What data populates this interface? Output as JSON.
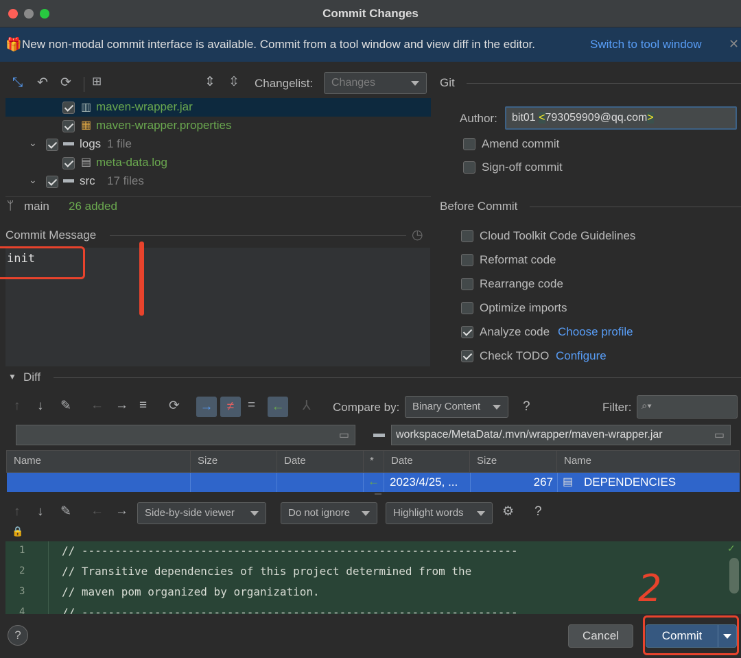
{
  "window": {
    "title": "Commit Changes"
  },
  "banner": {
    "message": "New non-modal commit interface is available. Commit from a tool window and view diff in the editor.",
    "link": "Switch to tool window"
  },
  "changes_toolbar": {
    "changelist_label": "Changelist:",
    "changelist_value": "Changes"
  },
  "tree": {
    "items": [
      {
        "label": "maven-wrapper.jar",
        "detail": "",
        "checked": true
      },
      {
        "label": "maven-wrapper.properties",
        "detail": "",
        "checked": true
      },
      {
        "label": "logs",
        "detail": "1 file",
        "checked": true
      },
      {
        "label": "meta-data.log",
        "detail": "",
        "checked": true
      },
      {
        "label": "src",
        "detail": "17 files",
        "checked": true
      }
    ]
  },
  "branch": {
    "name": "main",
    "status": "26 added"
  },
  "commit_message": {
    "label": "Commit Message",
    "value": "init"
  },
  "git": {
    "section_title": "Git",
    "author_label": "Author:",
    "author_name": "bit01",
    "author_lt": "<",
    "author_email": "793059909@qq.com",
    "author_gt": ">",
    "amend_label": "Amend commit",
    "signoff_label": "Sign-off commit"
  },
  "before_commit": {
    "section_title": "Before Commit",
    "options": [
      {
        "label": "Cloud Toolkit Code Guidelines",
        "checked": false
      },
      {
        "label": "Reformat code",
        "checked": false
      },
      {
        "label": "Rearrange code",
        "checked": false
      },
      {
        "label": "Optimize imports",
        "checked": false
      },
      {
        "label": "Analyze code",
        "link": "Choose profile",
        "checked": true
      },
      {
        "label": "Check TODO",
        "link": "Configure",
        "checked": true
      }
    ]
  },
  "diff": {
    "section_title": "Diff",
    "compare_by_label": "Compare by:",
    "compare_by_value": "Binary Content",
    "help": "?",
    "filter_label": "Filter:",
    "right_path": "workspace/MetaData/.mvn/wrapper/maven-wrapper.jar",
    "left_columns": [
      "Name",
      "Size",
      "Date"
    ],
    "mid_column": "*",
    "right_columns": [
      "Date",
      "Size",
      "Name"
    ],
    "row": {
      "date": "2023/4/25, ...",
      "size": "267",
      "name": "DEPENDENCIES"
    },
    "viewer_mode": "Side-by-side viewer",
    "ignore_mode": "Do not ignore",
    "highlight_mode": "Highlight words",
    "help2": "?",
    "code_lines": [
      {
        "n": "1",
        "text": "// ------------------------------------------------------------------"
      },
      {
        "n": "2",
        "text": "// Transitive dependencies of this project determined from the"
      },
      {
        "n": "3",
        "text": "// maven pom organized by organization."
      },
      {
        "n": "4",
        "text": "// ------------------------------------------------------------------"
      }
    ]
  },
  "footer": {
    "help": "?",
    "cancel": "Cancel",
    "commit": "Commit"
  },
  "annotation": {
    "label": "2"
  },
  "colors": {
    "accent": "#365880",
    "selection": "#2f65ca",
    "annotation": "#e8432c",
    "diff_bg": "#294436"
  }
}
